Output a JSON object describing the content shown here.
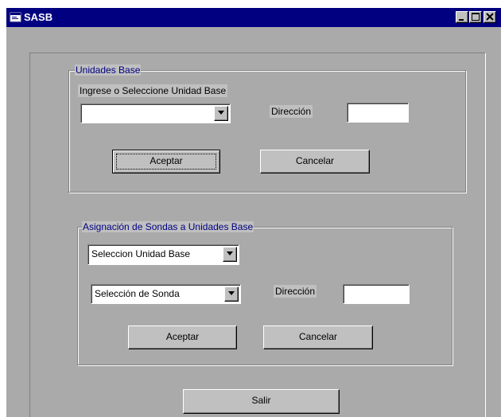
{
  "window": {
    "title": "SASB",
    "icon": "app-window-icon",
    "controls": [
      "minimize-icon",
      "maximize-icon",
      "close-icon"
    ]
  },
  "unidades_base": {
    "legend": "Unidades Base",
    "prompt": "Ingrese o Seleccione Unidad Base",
    "combo_value": "",
    "direccion_label": "Dirección",
    "direccion_value": "",
    "accept_label": "Aceptar",
    "cancel_label": "Cancelar"
  },
  "asignacion": {
    "legend": "Asignación de Sondas a Unidades Base",
    "unidad_combo_value": "Seleccion Unidad Base",
    "sonda_combo_value": "Selección de Sonda",
    "direccion_label": "Dirección",
    "direccion_value": "",
    "accept_label": "Aceptar",
    "cancel_label": "Cancelar"
  },
  "footer": {
    "exit_label": "Salir"
  },
  "colors": {
    "titlebar": "#000080",
    "face": "#c0c0c0",
    "legend_text": "#000080"
  }
}
